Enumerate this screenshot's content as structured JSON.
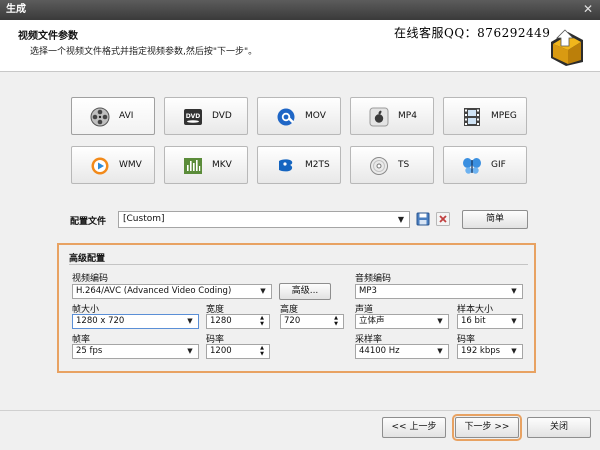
{
  "window": {
    "title": "生成"
  },
  "header": {
    "title": "视频文件参数",
    "subtitle": "选择一个视频文件格式并指定视频参数,然后按\"下一步\"。",
    "contact": "在线客服QQ：876292449"
  },
  "formats": [
    {
      "label": "AVI",
      "icon": "film-reel-icon",
      "selected": true
    },
    {
      "label": "DVD",
      "icon": "dvd-icon"
    },
    {
      "label": "MOV",
      "icon": "quicktime-icon"
    },
    {
      "label": "MP4",
      "icon": "apple-icon"
    },
    {
      "label": "MPEG",
      "icon": "filmstrip-icon"
    },
    {
      "label": "WMV",
      "icon": "media-player-icon"
    },
    {
      "label": "MKV",
      "icon": "equalizer-icon"
    },
    {
      "label": "M2TS",
      "icon": "bluray-disc-icon"
    },
    {
      "label": "TS",
      "icon": "disc-icon"
    },
    {
      "label": "GIF",
      "icon": "butterfly-icon"
    }
  ],
  "profile": {
    "label": "配置文件",
    "value": "[Custom]",
    "simple_button": "简单"
  },
  "advanced": {
    "title": "高级配置",
    "video_codec": {
      "label": "视频编码",
      "value": "H.264/AVC (Advanced Video Coding)",
      "button": "高级..."
    },
    "audio_codec": {
      "label": "音频编码",
      "value": "MP3"
    },
    "frame_size": {
      "label": "帧大小",
      "value": "1280 x 720"
    },
    "width": {
      "label": "宽度",
      "value": "1280"
    },
    "height": {
      "label": "高度",
      "value": "720"
    },
    "channels": {
      "label": "声道",
      "value": "立体声"
    },
    "sample_size": {
      "label": "样本大小",
      "value": "16 bit"
    },
    "frame_rate": {
      "label": "帧率",
      "value": "25 fps"
    },
    "bitrate": {
      "label": "码率",
      "value": "1200"
    },
    "sample_rate": {
      "label": "采样率",
      "value": "44100 Hz"
    },
    "audio_bitrate": {
      "label": "码率",
      "value": "192 kbps"
    }
  },
  "footer": {
    "prev": "<< 上一步",
    "next": "下一步 >>",
    "close": "关闭"
  },
  "colors": {
    "accent": "#e8a262",
    "titlebar": "#3f3f3f"
  }
}
